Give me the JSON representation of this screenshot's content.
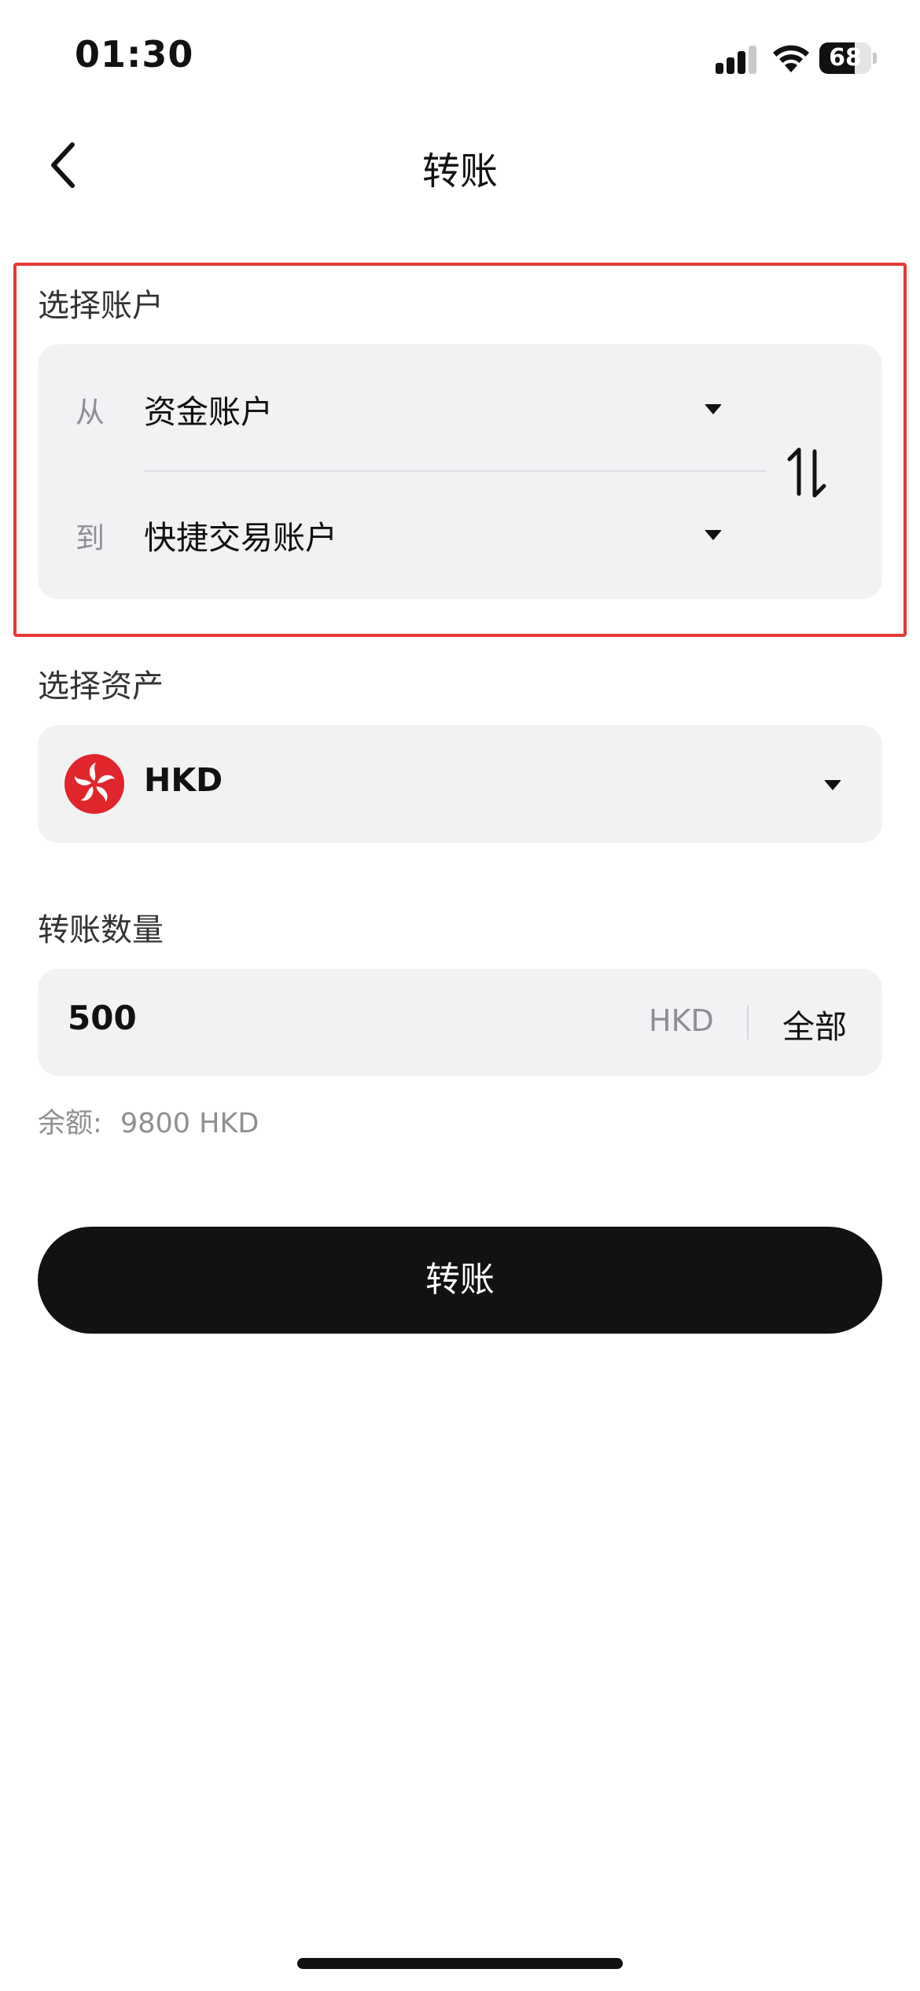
{
  "status_bar": {
    "time": "01:30",
    "battery_level": "68",
    "battery_fraction": 0.68
  },
  "nav": {
    "title": "转账",
    "back_icon": "chevron-left-icon"
  },
  "account_section": {
    "label": "选择账户",
    "from_label": "从",
    "from_value": "资金账户",
    "to_label": "到",
    "to_value": "快捷交易账户",
    "swap_icon": "swap-vertical-icon",
    "highlight_color": "#e53935"
  },
  "asset_section": {
    "label": "选择资产",
    "selected": "HKD",
    "flag_icon": "hong-kong-flag-icon",
    "flag_color": "#e0262b"
  },
  "amount_section": {
    "label": "转账数量",
    "value": "500",
    "unit": "HKD",
    "all_label": "全部"
  },
  "balance": {
    "label": "余额:",
    "value": "9800 HKD"
  },
  "submit": {
    "label": "转账"
  },
  "colors": {
    "card_bg": "#f1f2f4",
    "button_bg": "#111214",
    "muted_text": "#8e8e93"
  }
}
